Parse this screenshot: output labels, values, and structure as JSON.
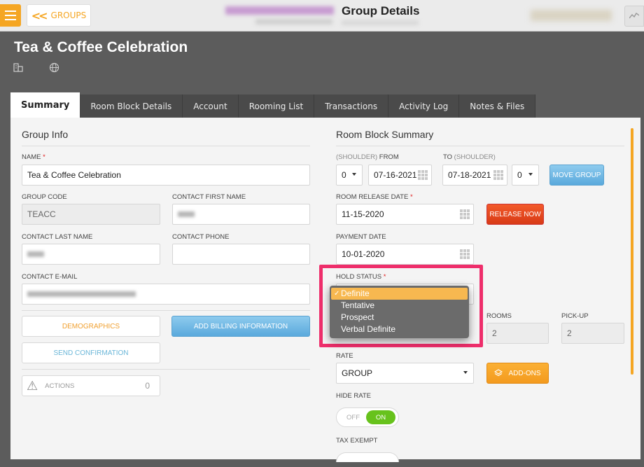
{
  "topbar": {
    "back_label": "GROUPS",
    "page_title": "Group Details"
  },
  "group": {
    "name": "Tea & Coffee Celebration"
  },
  "tabs": [
    {
      "label": "Summary",
      "active": true
    },
    {
      "label": "Room Block Details"
    },
    {
      "label": "Account"
    },
    {
      "label": "Rooming List"
    },
    {
      "label": "Transactions"
    },
    {
      "label": "Activity Log"
    },
    {
      "label": "Notes & Files"
    }
  ],
  "group_info": {
    "title": "Group Info",
    "name_label": "NAME",
    "name_value": "Tea & Coffee Celebration",
    "group_code_label": "GROUP CODE",
    "group_code_value": "TEACC",
    "contact_first_label": "CONTACT FIRST NAME",
    "contact_last_label": "CONTACT LAST NAME",
    "contact_phone_label": "CONTACT PHONE",
    "contact_email_label": "CONTACT E-MAIL",
    "demographics_label": "DEMOGRAPHICS",
    "add_billing_label": "ADD BILLING INFORMATION",
    "send_confirmation_label": "SEND CONFIRMATION",
    "actions_label": "ACTIONS",
    "actions_count": "0"
  },
  "room_block": {
    "title": "Room Block Summary",
    "shoulder_from_label_muted": "(SHOULDER)",
    "shoulder_from_label": " FROM",
    "to_label": "TO ",
    "shoulder_to_label_muted": "(SHOULDER)",
    "from_shoulder_value": "0",
    "from_date": "07-16-2021",
    "to_date": "07-18-2021",
    "to_shoulder_value": "0",
    "move_group_label": "MOVE GROUP",
    "release_date_label": "ROOM RELEASE DATE",
    "release_date_value": "11-15-2020",
    "release_now_label": "RELEASE NOW",
    "payment_date_label": "PAYMENT DATE",
    "payment_date_value": "10-01-2020",
    "hold_status_label": "HOLD STATUS",
    "rooms_label": "ROOMS",
    "rooms_value": "2",
    "pickup_label": "PICK-UP",
    "pickup_value": "2",
    "rate_label": "RATE",
    "rate_value": "GROUP",
    "addons_label": "ADD-ONS",
    "hide_rate_label": "HIDE RATE",
    "toggle_off": "OFF",
    "toggle_on": "ON",
    "tax_exempt_label": "TAX EXEMPT"
  },
  "hold_status_dropdown": {
    "options": [
      "Definite",
      "Tentative",
      "Prospect",
      "Verbal Definite"
    ],
    "selected": "Definite",
    "checkmark": "✓"
  },
  "colors": {
    "accent": "#f5a623",
    "highlight": "#ee2e6b",
    "toggle_on": "#67c21c",
    "release_now": "#e0441c",
    "move_group": "#6fb8e6"
  }
}
